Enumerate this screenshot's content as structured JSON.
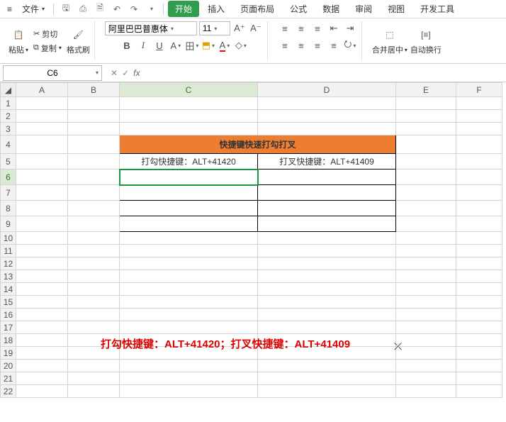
{
  "menu": {
    "file": "文件",
    "tabs": [
      "开始",
      "插入",
      "页面布局",
      "公式",
      "数据",
      "审阅",
      "视图",
      "开发工具"
    ],
    "active_tab_index": 0
  },
  "qat": {
    "icons": [
      "menu",
      "save",
      "print",
      "preview",
      "undo",
      "redo"
    ]
  },
  "ribbon": {
    "paste": "粘贴",
    "cut": "剪切",
    "copy": "复制",
    "format_painter": "格式刷",
    "font_name": "阿里巴巴普惠体",
    "font_size": "11",
    "merge_center": "合并居中",
    "wrap_text": "自动换行"
  },
  "namebox": {
    "value": "C6"
  },
  "columns": [
    "A",
    "B",
    "C",
    "D",
    "E",
    "F"
  ],
  "rows": [
    "1",
    "2",
    "3",
    "4",
    "5",
    "6",
    "7",
    "8",
    "9",
    "10",
    "11",
    "12",
    "13",
    "14",
    "15",
    "16",
    "17",
    "18",
    "19",
    "20",
    "21",
    "22"
  ],
  "cells": {
    "title": "快捷键快速打勾打叉",
    "c5": "打勾快捷键：ALT+41420",
    "d5": "打叉快捷键：ALT+41409"
  },
  "annotation": "打勾快捷键：ALT+41420；打叉快捷键：ALT+41409"
}
